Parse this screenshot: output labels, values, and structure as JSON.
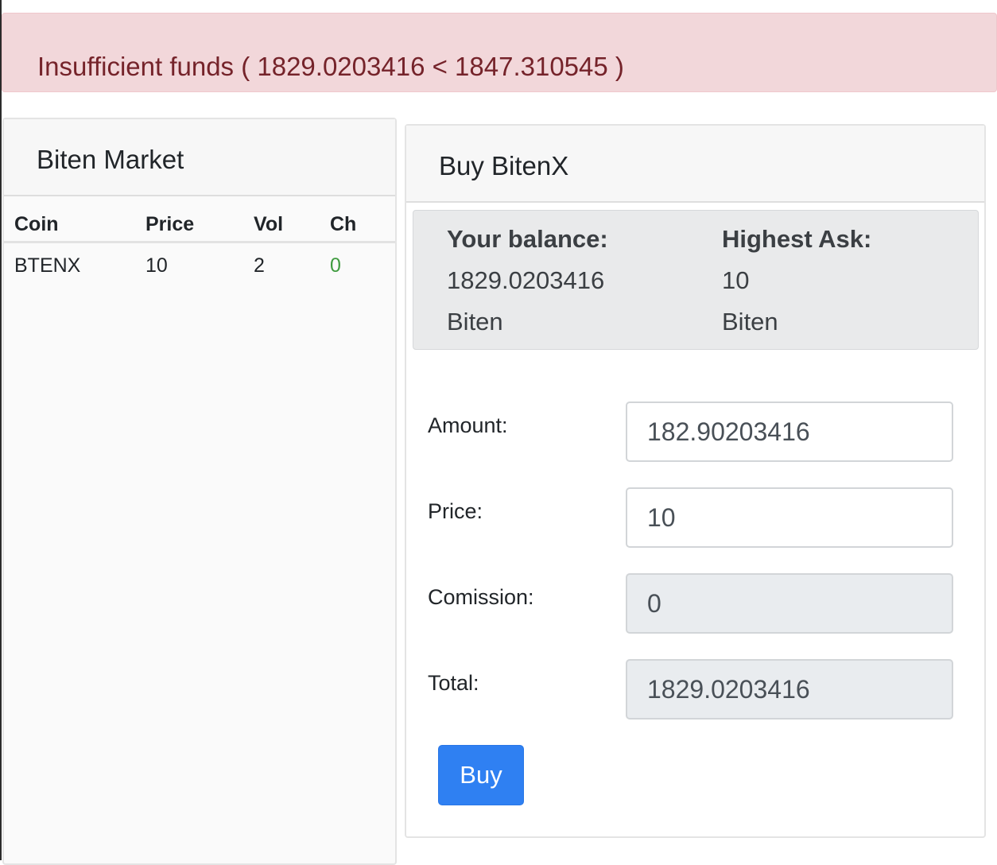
{
  "alert": {
    "message": "Insufficient funds ( 1829.0203416 < 1847.310545 )"
  },
  "market": {
    "title": "Biten Market",
    "columns": [
      "Coin",
      "Price",
      "Vol",
      "Ch"
    ],
    "rows": [
      {
        "coin": "BTENX",
        "price": "10",
        "vol": "2",
        "ch": "0"
      }
    ]
  },
  "buy": {
    "title": "Buy BitenX",
    "balance_label": "Your balance:",
    "balance_value": "1829.0203416",
    "balance_unit": "Biten",
    "highest_ask_label": "Highest Ask:",
    "highest_ask_value": "10",
    "highest_ask_unit": "Biten",
    "form": {
      "amount_label": "Amount:",
      "amount_value": "182.90203416",
      "price_label": "Price:",
      "price_value": "10",
      "commission_label": "Comission:",
      "commission_value": "0",
      "total_label": "Total:",
      "total_value": "1829.0203416"
    },
    "button_label": "Buy"
  },
  "colors": {
    "alert_bg": "#f2d7da",
    "alert_text": "#75232a",
    "change_positive": "#3f9b3f",
    "primary_button": "#2f80f2"
  }
}
